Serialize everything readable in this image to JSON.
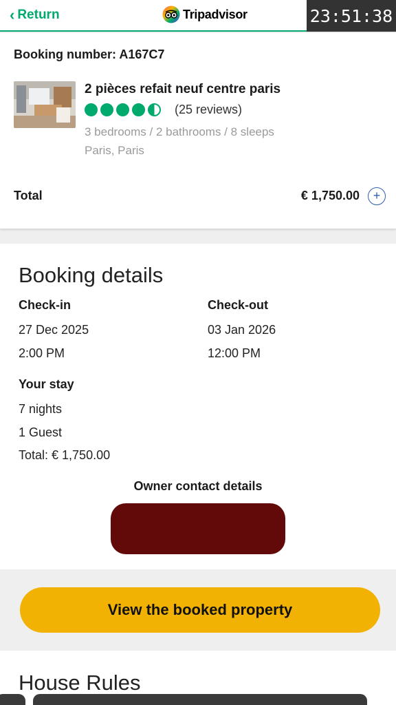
{
  "header": {
    "return_label": "Return",
    "brand": "Tripadvisor",
    "clock": "23:51:38",
    "accent_color": "#00aa6c"
  },
  "summary": {
    "booking_number": "Booking number: A167C7",
    "property_title": "2 pièces refait neuf centre paris",
    "rating_bubbles": 4.5,
    "reviews": "(25 reviews)",
    "details": "3 bedrooms / 2 bathrooms / 8 sleeps",
    "location": "Paris, Paris",
    "total_label": "Total",
    "total_value": "€ 1,750.00",
    "expand_icon": "plus-circle-icon"
  },
  "booking_details": {
    "title": "Booking details",
    "checkin_label": "Check-in",
    "checkin_date": "27 Dec 2025",
    "checkin_time": "2:00 PM",
    "checkout_label": "Check-out",
    "checkout_date": "03 Jan 2026",
    "checkout_time": "12:00 PM",
    "stay_label": "Your stay",
    "nights": "7 nights",
    "guests": "1 Guest",
    "stay_total": "Total: € 1,750.00",
    "owner_label": "Owner contact details",
    "owner_redaction_color": "#620a09"
  },
  "cta": {
    "label": "View the booked property",
    "color": "#f2b203"
  },
  "house_rules": {
    "title": "House Rules"
  }
}
